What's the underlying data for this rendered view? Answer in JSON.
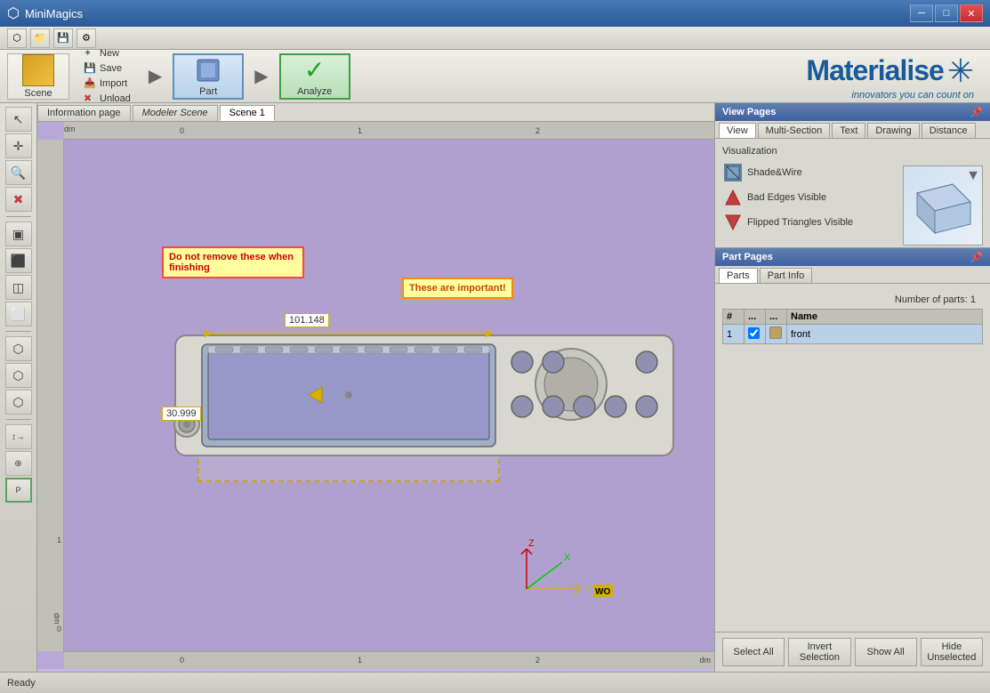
{
  "app": {
    "title": "MiniMagics",
    "status": "Ready"
  },
  "titlebar": {
    "minimize": "─",
    "maximize": "□",
    "close": "✕"
  },
  "toolbar": {
    "new_label": "New",
    "save_label": "Save",
    "import_label": "Import",
    "unload_label": "Unload",
    "scene_label": "Scene",
    "part_label": "Part",
    "analyze_label": "Analyze",
    "checkmark": "✓"
  },
  "tabs": {
    "items": [
      {
        "label": "Information page",
        "italic": false,
        "active": false
      },
      {
        "label": "Modeler Scene",
        "italic": true,
        "active": false
      },
      {
        "label": "Scene 1",
        "italic": false,
        "active": true
      }
    ]
  },
  "ruler": {
    "axis": "dm",
    "tick0": "0",
    "tick1": "1",
    "tick2": "2",
    "tick_y0": "0",
    "tick_y1": "1"
  },
  "annotations": {
    "note1": "Do not remove these when finishing",
    "note2": "These are important!",
    "dim_h": "101.148",
    "dim_v": "30.999"
  },
  "view_pages": {
    "title": "View Pages",
    "tabs": [
      {
        "label": "View",
        "active": true
      },
      {
        "label": "Multi-Section",
        "active": false
      },
      {
        "label": "Text",
        "active": false
      },
      {
        "label": "Drawing",
        "active": false
      },
      {
        "label": "Distance",
        "active": false
      }
    ],
    "visualization_title": "Visualization",
    "shade_wire": "Shade&Wire",
    "bad_edges": "Bad Edges Visible",
    "flipped_tri": "Flipped Triangles Visible"
  },
  "part_pages": {
    "title": "Part Pages",
    "tabs": [
      {
        "label": "Parts",
        "active": true
      },
      {
        "label": "Part Info",
        "active": false
      }
    ],
    "number_parts_label": "Number of parts: 1",
    "columns": {
      "num": "#",
      "vis": "...",
      "col": "...",
      "name": "Name"
    },
    "rows": [
      {
        "num": "1",
        "name": "front",
        "checked": true
      }
    ],
    "buttons": {
      "select_all": "Select All",
      "invert_selection": "Invert Selection",
      "show_all": "Show All",
      "hide_unselected": "Hide Unselected"
    }
  },
  "logo": {
    "name": "Materialise",
    "tagline": "innovators you can count on"
  }
}
